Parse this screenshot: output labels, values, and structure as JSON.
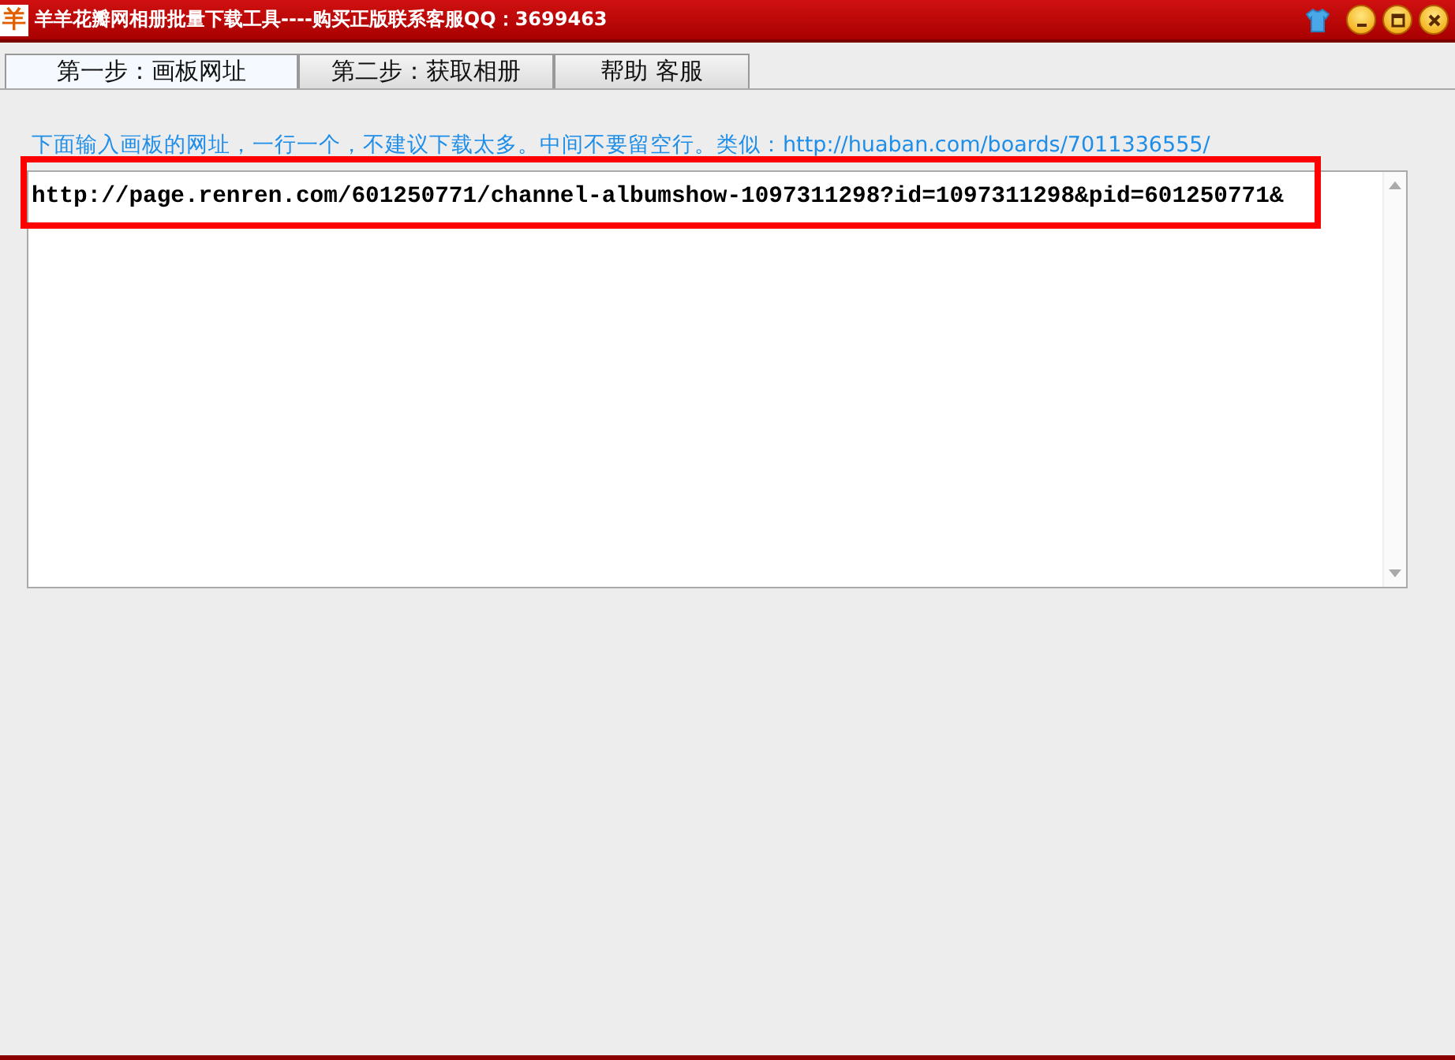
{
  "window": {
    "title": "羊羊花瓣网相册批量下载工具----购买正版联系客服QQ：3699463",
    "logo_char": "羊"
  },
  "tabs": [
    {
      "label": "第一步：画板网址",
      "selected": true
    },
    {
      "label": "第二步：获取相册",
      "selected": false
    },
    {
      "label": "帮助 客服",
      "selected": false
    }
  ],
  "instruction": "下面输入画板的网址，一行一个，不建议下载太多。中间不要留空行。类似：http://huaban.com/boards/7011336555/",
  "url_input": {
    "value": "http://page.renren.com/601250771/channel-albumshow-1097311298?id=1097311298&pid=601250771&",
    "highlighted": true
  }
}
